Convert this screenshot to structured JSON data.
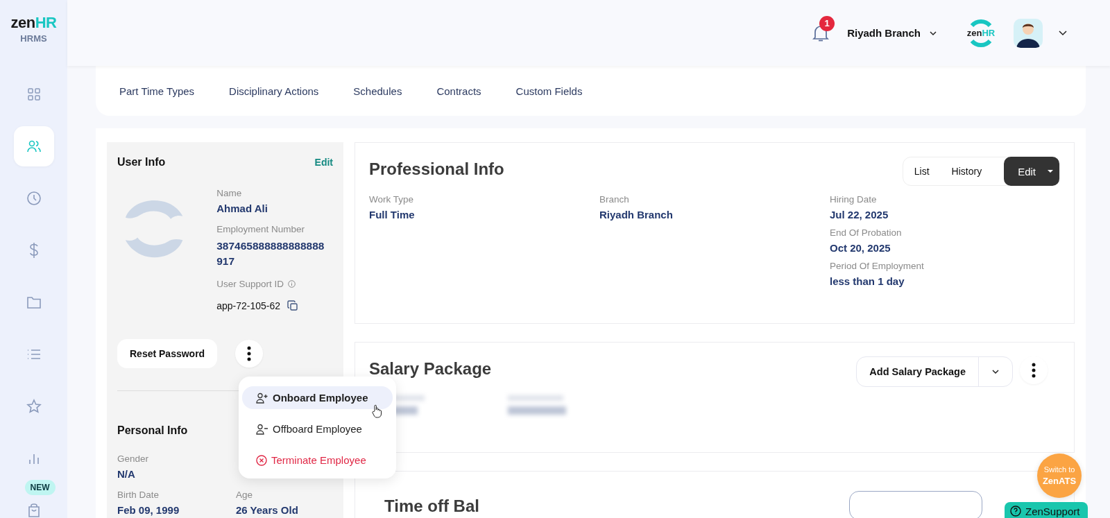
{
  "sidebar": {
    "logo": {
      "dark": "zen",
      "accent": "HR"
    },
    "subtitle": "HRMS",
    "items": [
      {
        "kind": "grid",
        "selected": false
      },
      {
        "kind": "people",
        "selected": true
      },
      {
        "kind": "clock",
        "selected": false
      },
      {
        "kind": "dollar",
        "selected": false
      },
      {
        "kind": "folder",
        "selected": false
      },
      {
        "kind": "list",
        "selected": false
      },
      {
        "kind": "star",
        "selected": false
      },
      {
        "kind": "chart",
        "selected": false
      },
      {
        "kind": "bag",
        "selected": false,
        "badge": "NEW"
      }
    ]
  },
  "header": {
    "notifications": "1",
    "branch": "Riyadh Branch",
    "brand": {
      "dark": "zen",
      "accent": "HR"
    }
  },
  "tabs": [
    "Part Time Types",
    "Disciplinary Actions",
    "Schedules",
    "Contracts",
    "Custom Fields"
  ],
  "user_info": {
    "title": "User Info",
    "edit": "Edit",
    "name_label": "Name",
    "name": "Ahmad Ali",
    "number_label": "Employment Number",
    "number": "387465888888888888917",
    "support_label": "User Support ID",
    "support_id": "app-72-105-62",
    "reset": "Reset Password"
  },
  "actions_menu": [
    {
      "kind": "onboard",
      "label": "Onboard Employee",
      "selected": true
    },
    {
      "kind": "offboard",
      "label": "Offboard Employee",
      "selected": false
    },
    {
      "kind": "terminate",
      "label": "Terminate Employee",
      "selected": false
    }
  ],
  "personal_info": {
    "title": "Personal Info",
    "fields": [
      {
        "label": "Gender",
        "value": "N/A"
      },
      {
        "label": "Birth Date",
        "value": "Feb 09, 1999"
      },
      {
        "label": "Age",
        "value": "26 Years Old"
      }
    ]
  },
  "professional_info": {
    "title": "Professional Info",
    "buttons": [
      "List",
      "History",
      "Edit"
    ],
    "columns": [
      [
        {
          "label": "Work Type",
          "value": "Full Time"
        }
      ],
      [
        {
          "label": "Branch",
          "value": "Riyadh Branch"
        }
      ],
      [
        {
          "label": "Hiring Date",
          "value": "Jul 22, 2025"
        },
        {
          "label": "End Of Probation",
          "value": "Oct 20, 2025"
        },
        {
          "label": "Period Of Employment",
          "value": "less than 1 day"
        }
      ]
    ]
  },
  "salary_package": {
    "title": "Salary Package",
    "add": "Add Salary Package"
  },
  "time_off": {
    "title": "Time off Bal"
  },
  "switch": {
    "line1": "Switch to",
    "line2": "ZenATS"
  },
  "support": "ZenSupport"
}
